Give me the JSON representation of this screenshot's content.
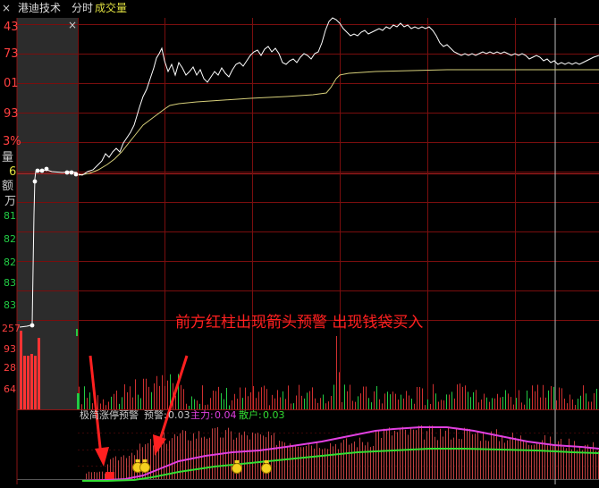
{
  "header": {
    "close_glyph": "×",
    "stock_name": "港迪技术",
    "view_mode": "分时",
    "sub_view": "成交量",
    "left_pane_close_glyph": "×"
  },
  "left_axis": {
    "price_labels": [
      "43",
      "73",
      "01",
      "93",
      "3%",
      "6"
    ],
    "volume_title": "量",
    "amount_title_1": "额",
    "amount_title_2": "万",
    "green_labels": [
      "81",
      "82",
      "82",
      "83",
      "83"
    ],
    "volume_labels": [
      "257",
      "93",
      "28",
      "64"
    ]
  },
  "indicator": {
    "name": "极简涨停预警",
    "warn_label": "预警:",
    "warn_value": "0.03",
    "main_label": "主力:",
    "main_value": "0.04",
    "retail_label": "散户:",
    "retail_value": "0.03"
  },
  "annotation": {
    "text": "前方红柱出现箭头预警 出现钱袋买入"
  },
  "colors": {
    "background": "#000000",
    "grid_red": "#7a0e0e",
    "price_line": "#ffffff",
    "avg_line": "#d6cf7a",
    "up_red": "#ff3333",
    "down_green": "#22cc44",
    "main_line": "#e040e0",
    "retail_line": "#33dd33",
    "annotation": "#ff2020",
    "axis_red": "#ff4040",
    "axis_yellow": "#e0e040"
  }
}
